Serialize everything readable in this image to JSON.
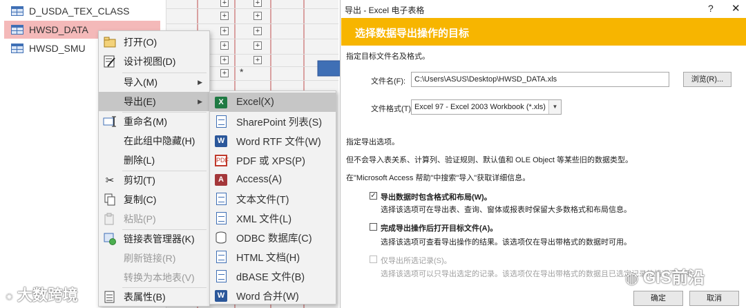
{
  "nav": {
    "items": [
      {
        "label": "D_USDA_TEX_CLASS",
        "selected": false
      },
      {
        "label": "HWSD_DATA",
        "selected": true
      },
      {
        "label": "HWSD_SMU",
        "selected": false
      }
    ]
  },
  "sheet": {
    "new_row_marker": "*",
    "expand_glyph": "+"
  },
  "context_menu": {
    "items": [
      {
        "label": "打开(O)",
        "icon": "open-icon",
        "disabled": false
      },
      {
        "label": "设计视图(D)",
        "icon": "design-view-icon",
        "disabled": false
      },
      {
        "label": "导入(M)",
        "icon": "",
        "disabled": false,
        "submenu": true
      },
      {
        "label": "导出(E)",
        "icon": "",
        "disabled": false,
        "submenu": true,
        "highlighted": true
      },
      {
        "label": "重命名(M)",
        "icon": "rename-icon",
        "disabled": false
      },
      {
        "label": "在此组中隐藏(H)",
        "icon": "",
        "disabled": false
      },
      {
        "label": "删除(L)",
        "icon": "",
        "disabled": false
      },
      {
        "label": "剪切(T)",
        "icon": "scissors-icon",
        "disabled": false
      },
      {
        "label": "复制(C)",
        "icon": "copy-icon",
        "disabled": false
      },
      {
        "label": "粘贴(P)",
        "icon": "paste-icon",
        "disabled": true
      },
      {
        "label": "链接表管理器(K)",
        "icon": "linked-table-manager-icon",
        "disabled": false
      },
      {
        "label": "刷新链接(R)",
        "icon": "",
        "disabled": true
      },
      {
        "label": "转换为本地表(V)",
        "icon": "",
        "disabled": true
      },
      {
        "label": "表属性(B)",
        "icon": "table-properties-icon",
        "disabled": false
      }
    ]
  },
  "export_menu": {
    "items": [
      {
        "label": "Excel(X)",
        "icon": "excel-icon",
        "highlighted": true
      },
      {
        "label": "SharePoint 列表(S)",
        "icon": "sharepoint-list-icon"
      },
      {
        "label": "Word RTF 文件(W)",
        "icon": "word-icon"
      },
      {
        "label": "PDF 或 XPS(P)",
        "icon": "pdf-icon"
      },
      {
        "label": "Access(A)",
        "icon": "access-icon"
      },
      {
        "label": "文本文件(T)",
        "icon": "text-file-icon"
      },
      {
        "label": "XML 文件(L)",
        "icon": "xml-file-icon"
      },
      {
        "label": "ODBC 数据库(C)",
        "icon": "odbc-database-icon"
      },
      {
        "label": "HTML 文档(H)",
        "icon": "html-document-icon"
      },
      {
        "label": "dBASE 文件(B)",
        "icon": "dbase-file-icon"
      },
      {
        "label": "Word 合并(W)",
        "icon": "word-merge-icon"
      }
    ]
  },
  "dialog": {
    "title": "导出 - Excel 电子表格",
    "help": "?",
    "close": "✕",
    "banner": "选择数据导出操作的目标",
    "target_heading": "指定目标文件名及格式。",
    "filename_label": "文件名(F):",
    "filename_value": "C:\\Users\\ASUS\\Desktop\\HWSD_DATA.xls",
    "browse_button": "浏览(R)...",
    "format_label": "文件格式(T):",
    "format_value": "Excel 97 - Excel 2003 Workbook (*.xls)",
    "options_heading": "指定导出选项。",
    "info_line1": "但不会导入表关系、计算列、验证规则、默认值和 OLE Object 等某些旧的数据类型。",
    "info_line2": "在\"Microsoft Access 帮助\"中搜索\"导入\"获取详细信息。",
    "option1_label": "导出数据时包含格式和布局(W)。",
    "option1_checked": true,
    "option1_desc": "选择该选项可在导出表、查询、窗体或报表时保留大多数格式和布局信息。",
    "option2_label": "完成导出操作后打开目标文件(A)。",
    "option2_checked": false,
    "option2_desc": "选择该选项可查看导出操作的结果。该选项仅在导出带格式的数据时可用。",
    "option3_label": "仅导出所选记录(S)。",
    "option3_checked": false,
    "option3_desc": "选择该选项可以只导出选定的记录。该选项仅在导出带格式的数据且已选定记录的情况下可用。",
    "ok_button": "确定",
    "cancel_button": "取消"
  },
  "watermarks": {
    "left": "大数跨境",
    "right": "GIS前沿"
  },
  "colors": {
    "banner": "#f7b500",
    "selected_nav": "#f4b9b9",
    "arrow": "#3f6fb5"
  }
}
